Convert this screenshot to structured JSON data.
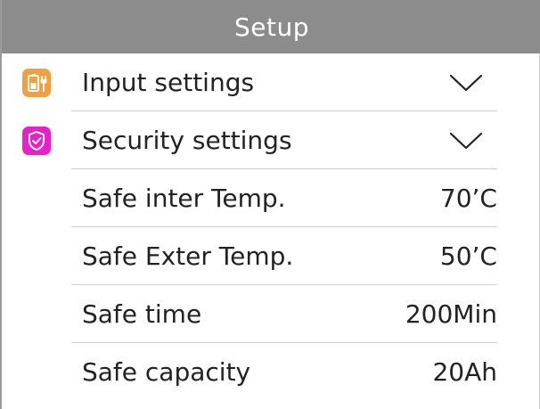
{
  "header": {
    "title": "Setup"
  },
  "rows": [
    {
      "label": "Input settings",
      "icon": "battery-plug-icon",
      "value": "",
      "type": "expand"
    },
    {
      "label": "Security settings",
      "icon": "shield-check-icon",
      "value": "",
      "type": "expand"
    },
    {
      "label": "Safe inter Temp.",
      "value": "70’C",
      "type": "value"
    },
    {
      "label": "Safe Exter Temp.",
      "value": "50’C",
      "type": "value"
    },
    {
      "label": "Safe time",
      "value": "200Min",
      "type": "value"
    },
    {
      "label": "Safe capacity",
      "value": "20Ah",
      "type": "value"
    }
  ],
  "colors": {
    "header_bg": "#8c8c8c",
    "input_icon_bg": "#f0a040",
    "security_icon_bg": "#e820c8",
    "divider": "#cfcfcf"
  }
}
